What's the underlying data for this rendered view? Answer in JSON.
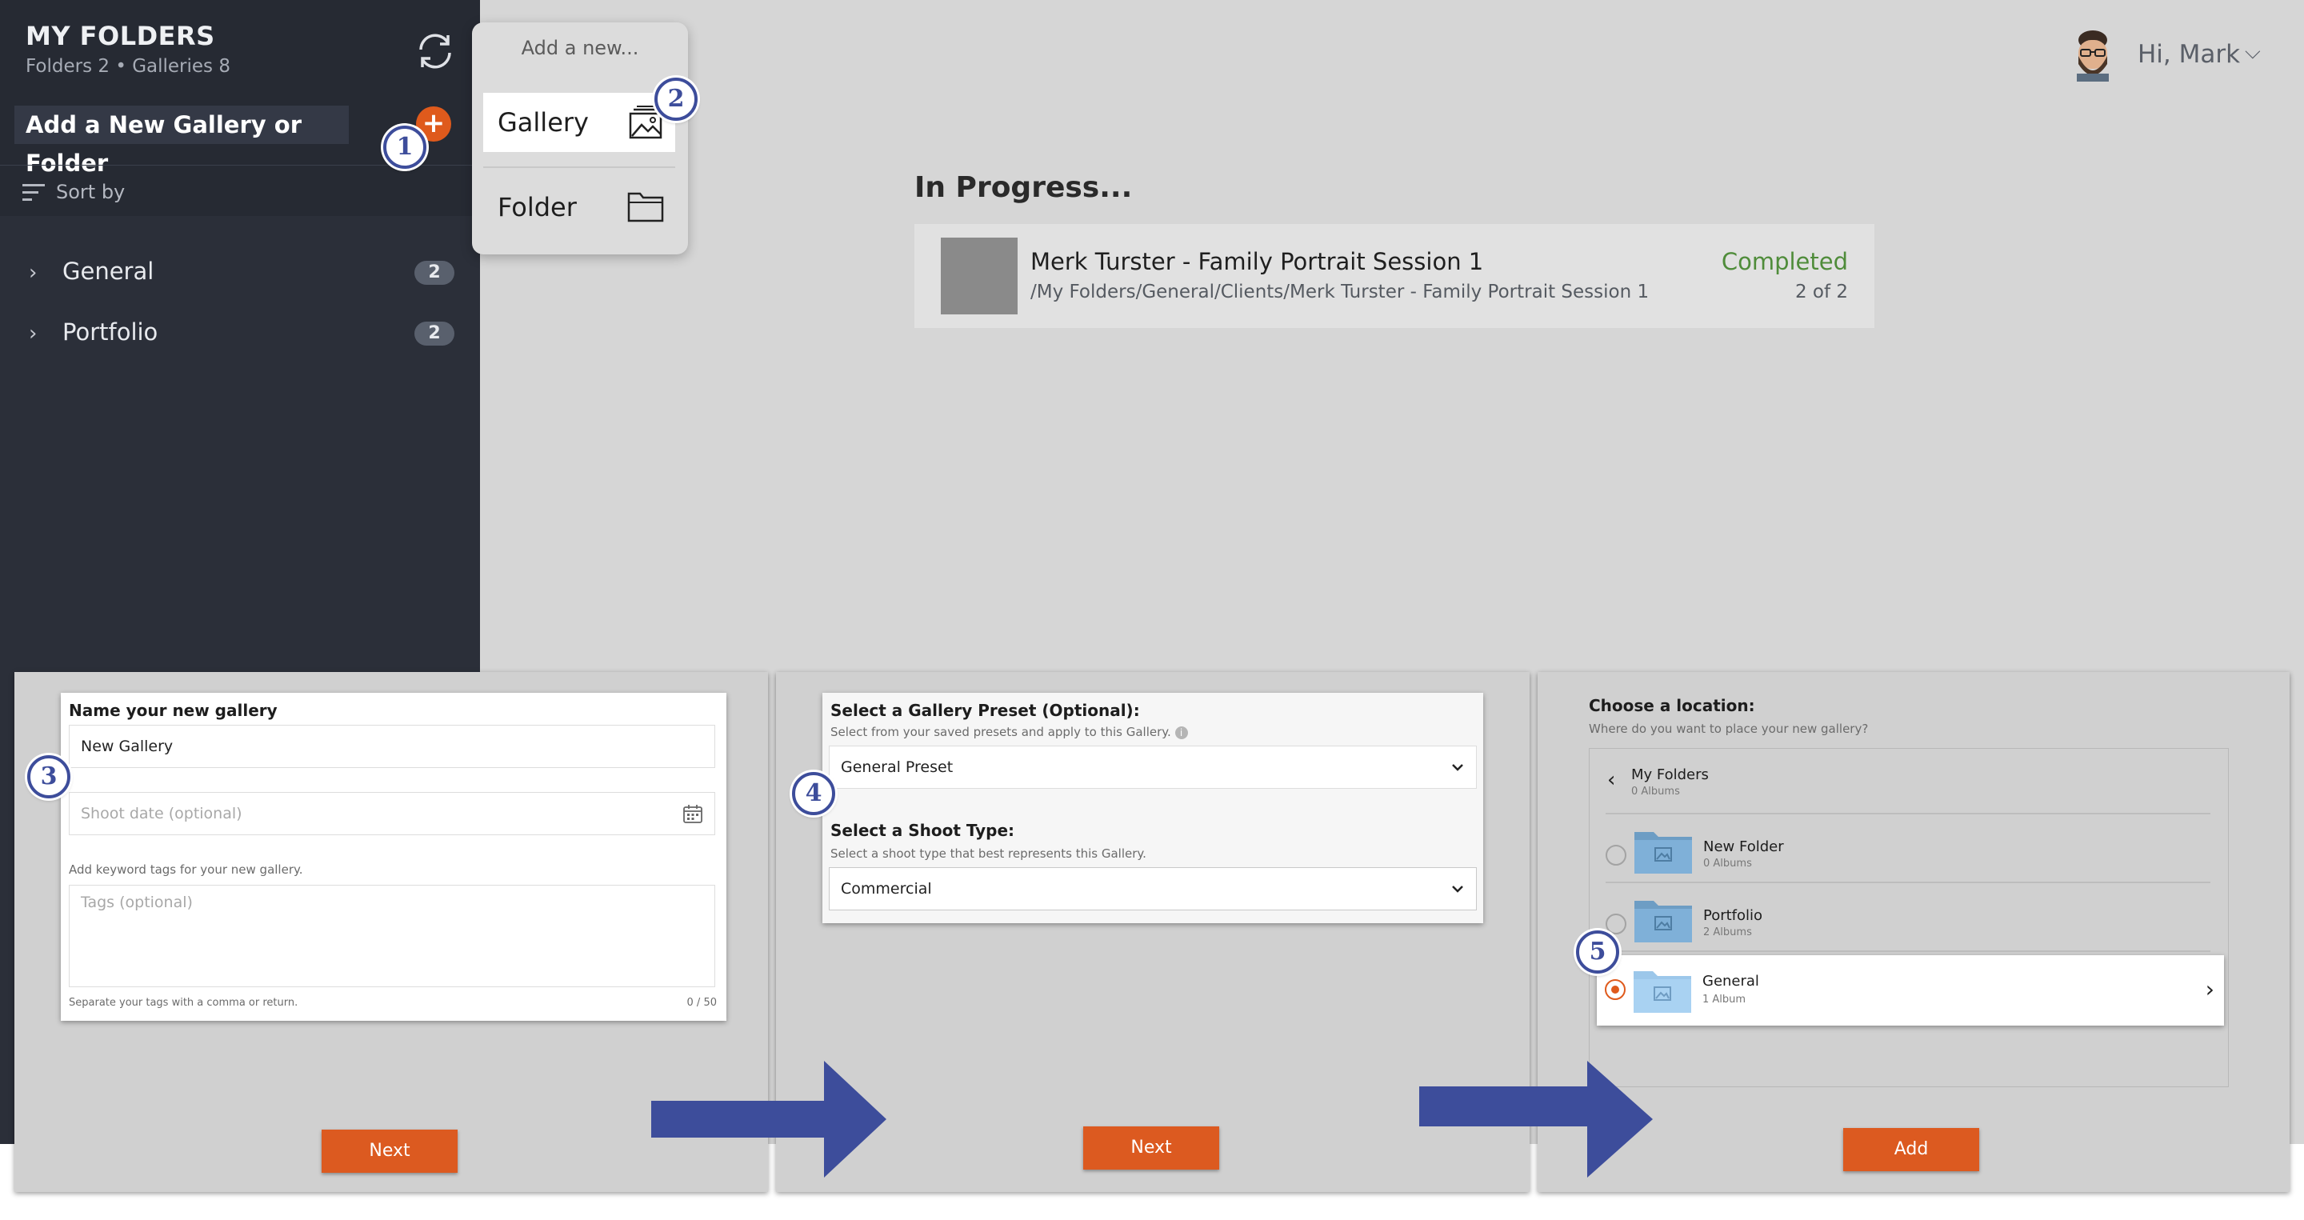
{
  "sidebar": {
    "title": "MY FOLDERS",
    "subtitle": "Folders 2 • Galleries 8",
    "add_label": "Add a New Gallery or Folder",
    "plus": "+",
    "sort_label": "Sort by",
    "items": [
      {
        "label": "General",
        "count": "2"
      },
      {
        "label": "Portfolio",
        "count": "2"
      }
    ]
  },
  "popover": {
    "title": "Add a new...",
    "options": [
      {
        "label": "Gallery",
        "icon": "gallery-icon"
      },
      {
        "label": "Folder",
        "icon": "folder-icon"
      }
    ]
  },
  "header": {
    "greeting": "Hi, Mark",
    "chevron": "⌵"
  },
  "main": {
    "section_title": "In Progress...",
    "upload": {
      "title": "Merk Turster - Family Portrait Session 1",
      "path": "/My Folders/General/Clients/Merk Turster - Family Portrait Session 1",
      "status": "Completed",
      "count": "2 of 2"
    }
  },
  "steps": {
    "s1": "1",
    "s2": "2",
    "s3": "3",
    "s4": "4",
    "s5": "5"
  },
  "panel1": {
    "heading": "Name your new gallery",
    "name_value": "New Gallery",
    "date_placeholder": "Shoot date (optional)",
    "tags_hint": "Add keyword tags for your new gallery.",
    "tags_placeholder": "Tags (optional)",
    "tags_footer": "Separate your tags with a comma or return.",
    "tags_counter": "0 / 50",
    "next": "Next"
  },
  "panel2": {
    "preset_heading": "Select a Gallery Preset (Optional):",
    "preset_hint": "Select from your saved presets and apply to this Gallery.",
    "preset_value": "General Preset",
    "shoot_heading": "Select a Shoot Type:",
    "shoot_hint": "Select a shoot type that best represents this Gallery.",
    "shoot_value": "Commercial",
    "next": "Next"
  },
  "panel3": {
    "heading": "Choose a location:",
    "hint": "Where do you want to place your new gallery?",
    "root": {
      "name": "My Folders",
      "meta": "0 Albums"
    },
    "folders": [
      {
        "name": "New Folder",
        "meta": "0 Albums",
        "selected": false
      },
      {
        "name": "Portfolio",
        "meta": "2 Albums",
        "selected": false
      },
      {
        "name": "General",
        "meta": "1 Album",
        "selected": true
      }
    ],
    "add": "Add"
  },
  "colors": {
    "accent": "#dc5a20",
    "step_blue": "#3d4d9b",
    "sidebar": "#2b2f39",
    "success": "#4f8c3a"
  }
}
